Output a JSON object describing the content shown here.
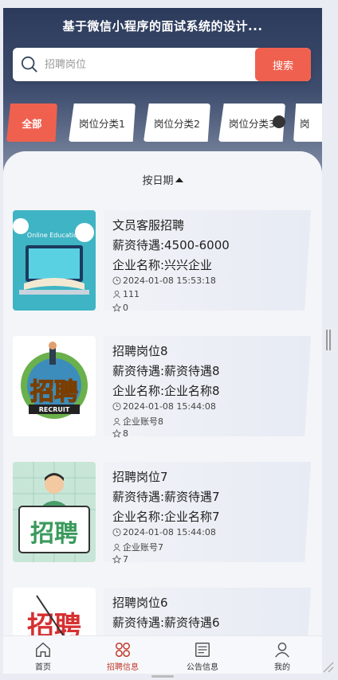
{
  "header": {
    "title": "基于微信小程序的面试系统的设计..."
  },
  "search": {
    "placeholder": "招聘岗位",
    "button_label": "搜索"
  },
  "categories": [
    {
      "label": "全部",
      "active": true
    },
    {
      "label": "岗位分类1"
    },
    {
      "label": "岗位分类2"
    },
    {
      "label": "岗位分类3"
    },
    {
      "label": "岗"
    }
  ],
  "sort": {
    "label": "按日期"
  },
  "jobs": [
    {
      "title": "文员客服招聘",
      "salary": "薪资待遇:4500-6000",
      "company": "企业名称:兴兴企业",
      "time": "2024-01-08 15:53:18",
      "account": "111",
      "likes": "0",
      "thumb_text": "Online Education"
    },
    {
      "title": "招聘岗位8",
      "salary": "薪资待遇:薪资待遇8",
      "company": "企业名称:企业名称8",
      "time": "2024-01-08 15:44:08",
      "account": "企业账号8",
      "likes": "8",
      "thumb_text": "招聘",
      "thumb_sub": "RECRUIT"
    },
    {
      "title": "招聘岗位7",
      "salary": "薪资待遇:薪资待遇7",
      "company": "企业名称:企业名称7",
      "time": "2024-01-08 15:44:08",
      "account": "企业账号7",
      "likes": "7",
      "thumb_text": "招聘"
    },
    {
      "title": "招聘岗位6",
      "salary": "薪资待遇:薪资待遇6",
      "thumb_text": "招聘"
    }
  ],
  "tabbar": [
    {
      "label": "首页",
      "icon": "home-icon"
    },
    {
      "label": "招聘信息",
      "icon": "recruit-icon",
      "active": true
    },
    {
      "label": "公告信息",
      "icon": "notice-icon"
    },
    {
      "label": "我的",
      "icon": "user-icon"
    }
  ],
  "colors": {
    "accent": "#f0604f",
    "header": "#2c3b5c",
    "active_tab": "#c0392b"
  }
}
